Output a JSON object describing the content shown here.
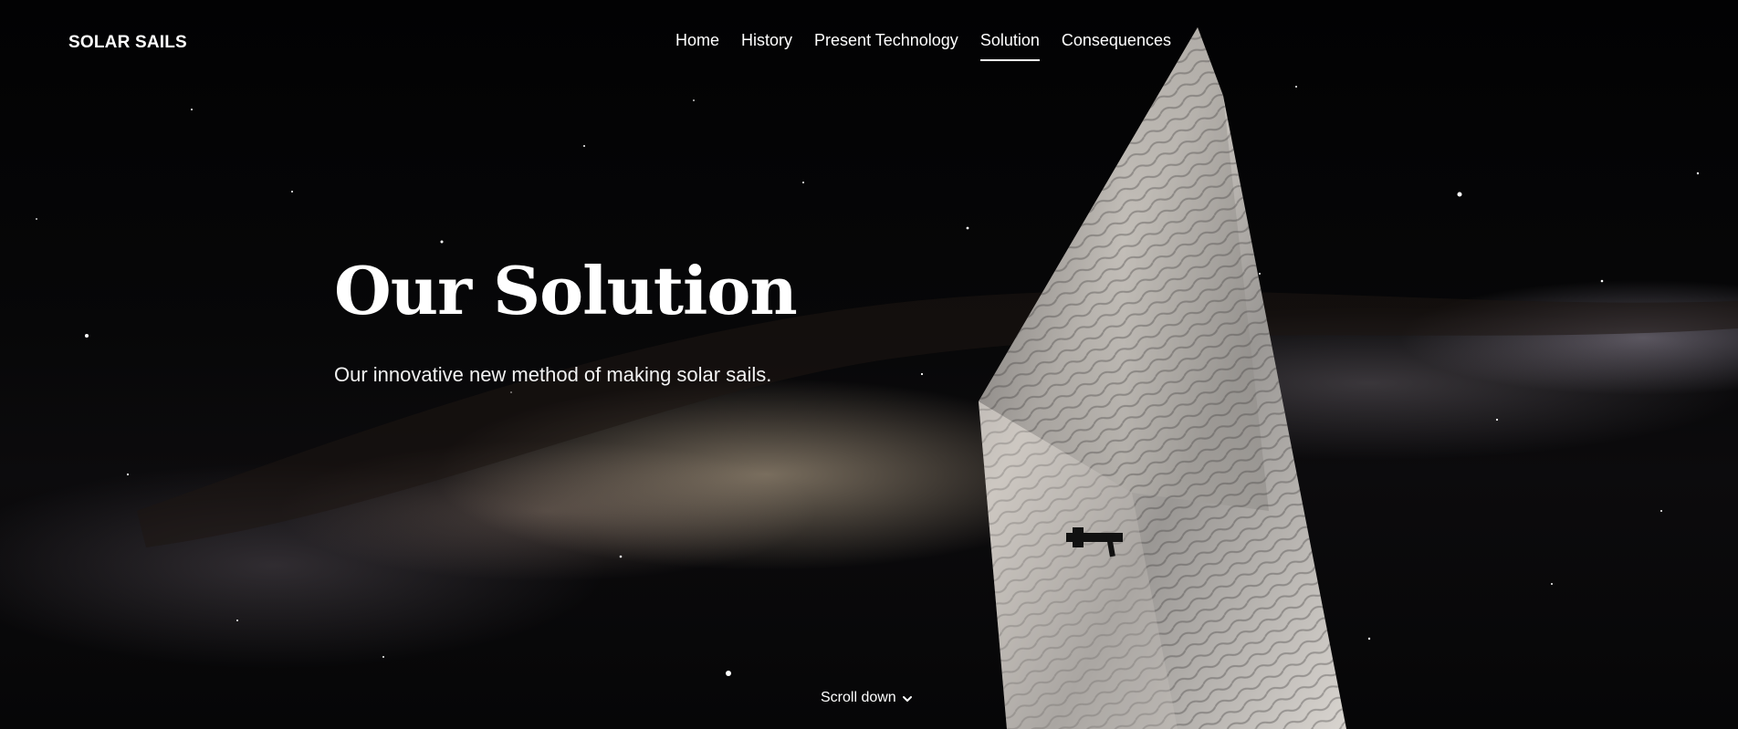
{
  "brand": {
    "name": "SOLAR SAILS"
  },
  "nav": {
    "items": [
      {
        "label": "Home",
        "active": false
      },
      {
        "label": "History",
        "active": false
      },
      {
        "label": "Present Technology",
        "active": false
      },
      {
        "label": "Solution",
        "active": true
      },
      {
        "label": "Consequences",
        "active": false
      }
    ]
  },
  "hero": {
    "title": "Our Solution",
    "subtitle": "Our innovative new method of making solar sails."
  },
  "scroll": {
    "label": "Scroll down",
    "icon": "chevron-down-icon"
  },
  "background": {
    "image": "milky-way-with-solar-sail",
    "sky_color": "#050506",
    "sail_color": "#b9b6b2"
  }
}
